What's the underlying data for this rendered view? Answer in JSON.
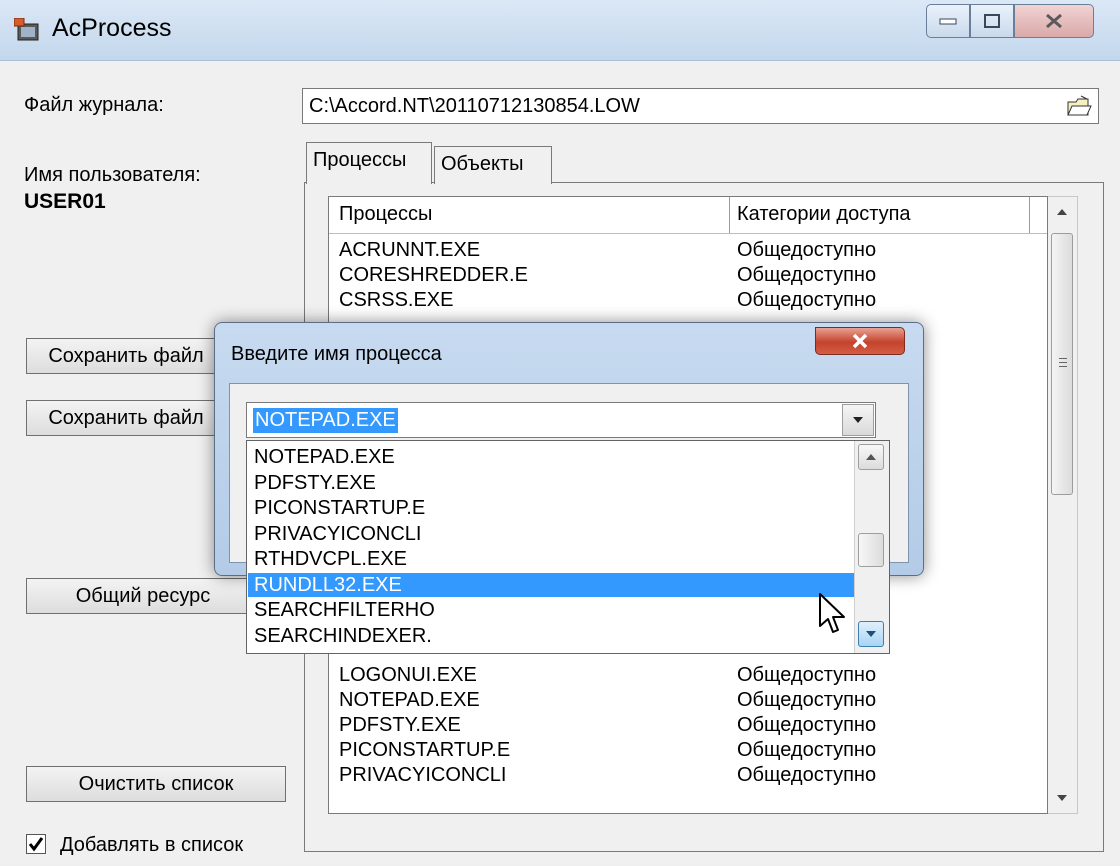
{
  "window": {
    "title": "AcProcess",
    "minimize_icon": "minimize-icon",
    "maximize_icon": "maximize-icon",
    "close_icon": "close-icon"
  },
  "log_file": {
    "label": "Файл журнала:",
    "value": "C:\\Accord.NT\\20110712130854.LOW",
    "browse_icon": "folder-open-icon"
  },
  "user": {
    "label": "Имя пользователя:",
    "name": "USER01"
  },
  "buttons": {
    "save_file_1": "Сохранить файл",
    "save_file_2": "Сохранить файл",
    "shared_resource": "Общий ресурс",
    "clear_list": "Очистить список"
  },
  "add_to_list": {
    "label": "Добавлять в список",
    "checked": true
  },
  "tabs": [
    {
      "label": "Процессы",
      "active": true
    },
    {
      "label": "Объекты",
      "active": false
    }
  ],
  "process_list": {
    "columns": [
      "Процессы",
      "Категории доступа"
    ],
    "rows": [
      [
        "ACRUNNT.EXE",
        "Общедоступно"
      ],
      [
        "CORESHREDDER.E",
        "Общедоступно"
      ],
      [
        "CSRSS.EXE",
        "Общедоступно"
      ],
      [
        "",
        ""
      ],
      [
        "",
        ""
      ],
      [
        "",
        ""
      ],
      [
        "",
        ""
      ],
      [
        "",
        ""
      ],
      [
        "",
        ""
      ],
      [
        "",
        ""
      ],
      [
        "",
        ""
      ],
      [
        "",
        ""
      ],
      [
        "",
        ""
      ],
      [
        "",
        ""
      ],
      [
        "",
        ""
      ],
      [
        "",
        ""
      ],
      [
        "",
        ""
      ],
      [
        "LOGONUI.EXE",
        "Общедоступно"
      ],
      [
        "NOTEPAD.EXE",
        "Общедоступно"
      ],
      [
        "PDFSTY.EXE",
        "Общедоступно"
      ],
      [
        "PICONSTARTUP.E",
        "Общедоступно"
      ],
      [
        "PRIVACYICONCLI",
        "Общедоступно"
      ]
    ]
  },
  "dialog": {
    "title": "Введите имя процесса",
    "close_icon": "close-icon",
    "combo_value": "NOTEPAD.EXE",
    "options": [
      "NOTEPAD.EXE",
      "PDFSTY.EXE",
      "PICONSTARTUP.E",
      "PRIVACYICONCLI",
      "RTHDVCPL.EXE",
      "RUNDLL32.EXE",
      "SEARCHFILTERHO",
      "SEARCHINDEXER."
    ],
    "highlighted_option": "RUNDLL32.EXE"
  },
  "colors": {
    "selection": "#3399ff",
    "window_bg": "#f0f0f0",
    "titlebar": "#c3d7ec",
    "dialog_close": "#c4432c"
  }
}
